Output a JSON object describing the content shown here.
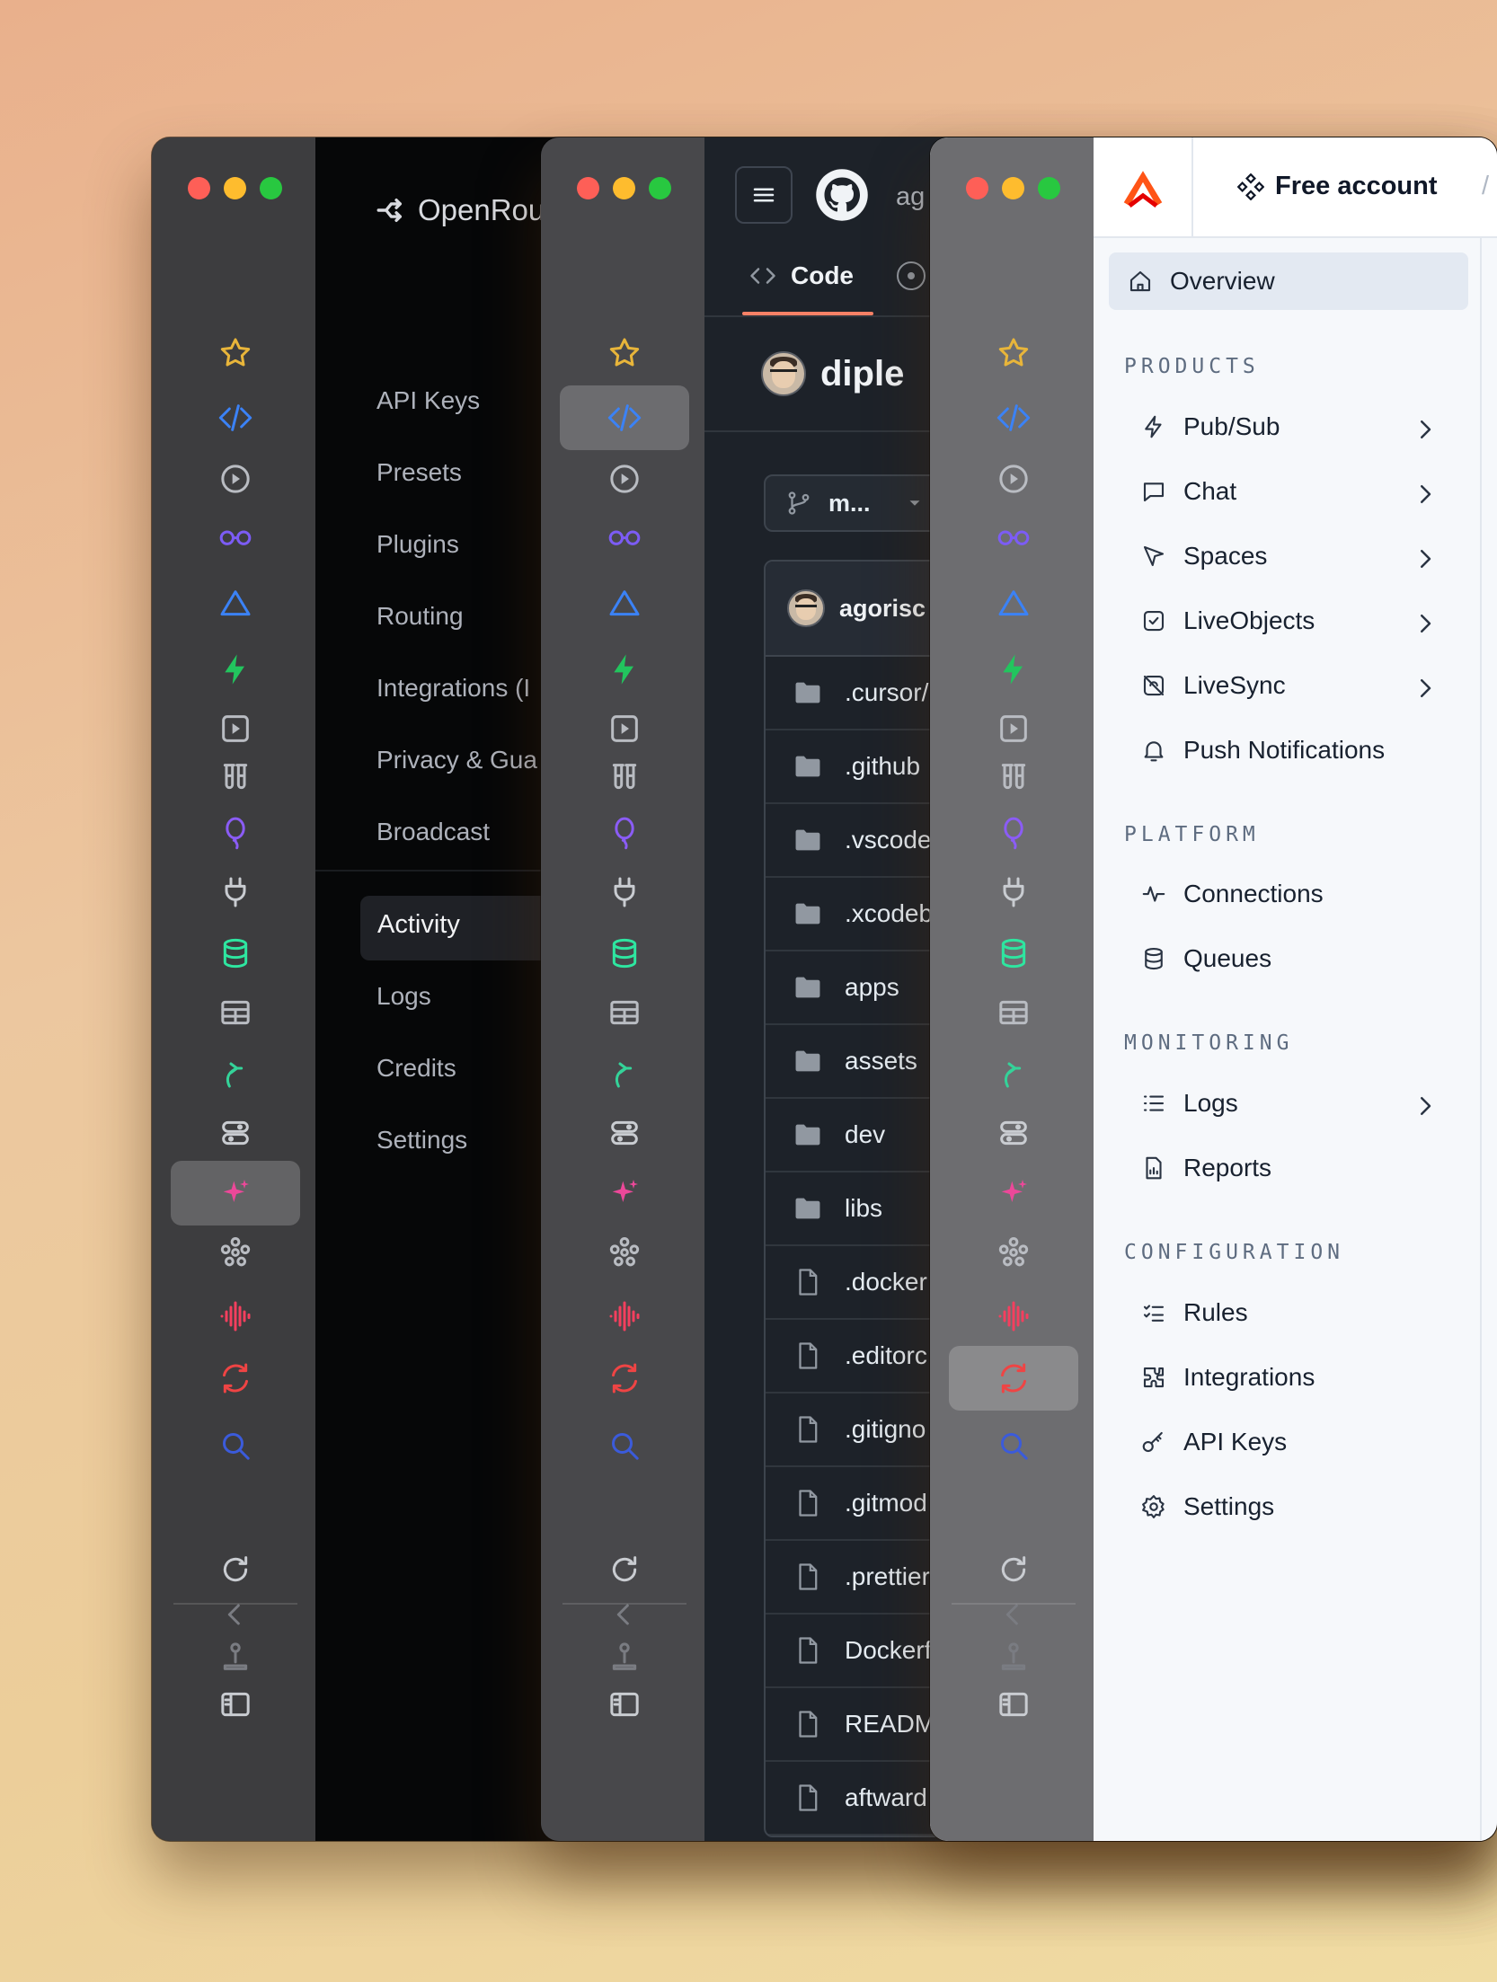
{
  "windows": {
    "openrouter": {
      "brand": "OpenRou",
      "nav_top": [
        "API Keys",
        "Presets",
        "Plugins",
        "Routing",
        "Integrations (I",
        "Privacy & Gua",
        "Broadcast"
      ],
      "nav_bottom": [
        "Activity",
        "Logs",
        "Credits",
        "Settings"
      ],
      "active_item": "Activity"
    },
    "github": {
      "owner_partial": "ag",
      "tabs": {
        "code": "Code"
      },
      "repo_name": "diple",
      "branch": "m...",
      "commit_user": "agorisc",
      "files": [
        {
          "name": ".cursor/",
          "type": "folder"
        },
        {
          "name": ".github",
          "type": "folder"
        },
        {
          "name": ".vscode",
          "type": "folder"
        },
        {
          "name": ".xcodeb",
          "type": "folder"
        },
        {
          "name": "apps",
          "type": "folder"
        },
        {
          "name": "assets",
          "type": "folder"
        },
        {
          "name": "dev",
          "type": "folder"
        },
        {
          "name": "libs",
          "type": "folder"
        },
        {
          "name": ".docker",
          "type": "file"
        },
        {
          "name": ".editorc",
          "type": "file"
        },
        {
          "name": ".gitigno",
          "type": "file"
        },
        {
          "name": ".gitmod",
          "type": "file"
        },
        {
          "name": ".prettier",
          "type": "file"
        },
        {
          "name": "Dockerf",
          "type": "file"
        },
        {
          "name": "READM",
          "type": "file"
        },
        {
          "name": "aftward",
          "type": "file"
        }
      ]
    },
    "ably": {
      "account_label": "Free account",
      "breadcrumb_sep": "/",
      "overview": "Overview",
      "sections": {
        "products": "PRODUCTS",
        "platform": "PLATFORM",
        "monitoring": "MONITORING",
        "configuration": "CONFIGURATION"
      },
      "products": [
        "Pub/Sub",
        "Chat",
        "Spaces",
        "LiveObjects",
        "LiveSync",
        "Push Notifications"
      ],
      "platform": [
        "Connections",
        "Queues"
      ],
      "monitoring": [
        "Logs",
        "Reports"
      ],
      "configuration": [
        "Rules",
        "Integrations",
        "API Keys",
        "Settings"
      ]
    }
  },
  "rail_icons": [
    {
      "name": "star-icon",
      "color": "#e8b53a"
    },
    {
      "name": "code-icon",
      "color": "#3b82f6"
    },
    {
      "name": "play-circle-icon",
      "color": "#b9bcc2"
    },
    {
      "name": "glasses-icon",
      "color": "#7c5cf5"
    },
    {
      "name": "triangle-icon",
      "color": "#3b82f6"
    },
    {
      "name": "bolt-icon",
      "color": "#22c55e"
    },
    {
      "name": "play-square-icon",
      "color": "#b9bcc2"
    },
    {
      "name": "test-tubes-icon",
      "color": "#b9bcc2"
    },
    {
      "name": "balloon-icon",
      "color": "#8b5cf6"
    },
    {
      "name": "plug-icon",
      "color": "#c9ccd1"
    },
    {
      "name": "database-icon",
      "color": "#2ee6a0"
    },
    {
      "name": "table-icon",
      "color": "#b9bcc2"
    },
    {
      "name": "arrow-up-icon",
      "color": "#34d399"
    },
    {
      "name": "toggles-icon",
      "color": "#c9ccd1"
    },
    {
      "name": "sparkles-icon",
      "color": "#ec4899"
    },
    {
      "name": "nodes-icon",
      "color": "#b9bcc2"
    },
    {
      "name": "waveform-icon",
      "color": "#f43f5e"
    },
    {
      "name": "sync-icon",
      "color": "#ef4444"
    },
    {
      "name": "search-icon",
      "color": "#3b5bdb"
    }
  ],
  "rail_bottom_icons": [
    "reload-icon",
    "back-icon",
    "joystick-icon",
    "sidebar-toggle-icon"
  ],
  "rail_active": {
    "openrouter": "sparkles-icon",
    "github": "code-icon",
    "ably": "sync-icon"
  }
}
